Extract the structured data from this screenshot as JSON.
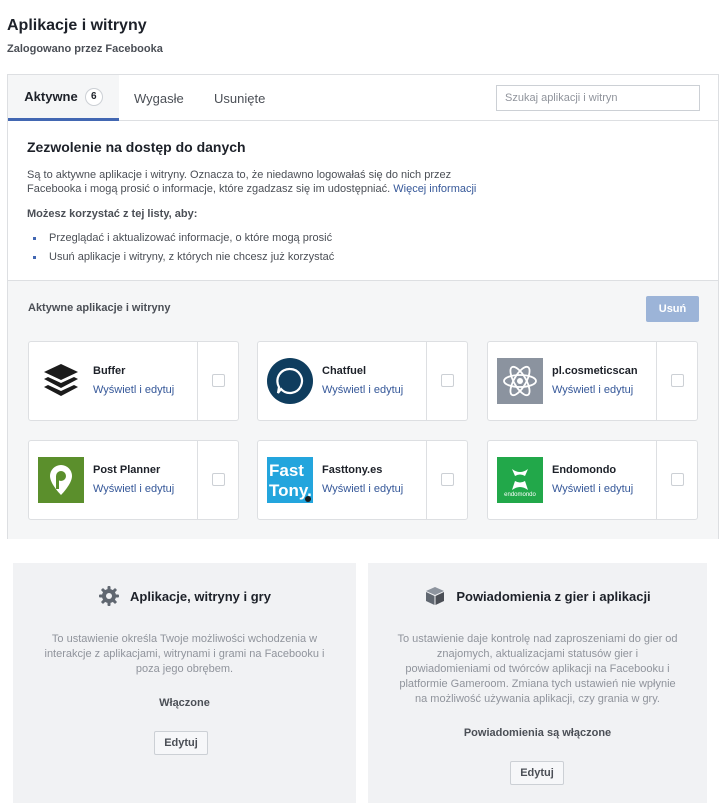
{
  "header": {
    "title": "Aplikacje i witryny",
    "subtitle": "Zalogowano przez Facebooka"
  },
  "tabs": [
    {
      "label": "Aktywne",
      "count": "6",
      "active": true
    },
    {
      "label": "Wygasłe"
    },
    {
      "label": "Usunięte"
    }
  ],
  "search": {
    "placeholder": "Szukaj aplikacji i witryn",
    "value": ""
  },
  "info": {
    "title": "Zezwolenie na dostęp do danych",
    "description": "Są to aktywne aplikacje i witryny. Oznacza to, że niedawno logowałaś się do nich przez Facebooka i mogą prosić o informacje, które zgadzasz się im udostępniać.",
    "more_link": "Więcej informacji",
    "subtitle": "Możesz korzystać z tej listy, aby:",
    "bullets": [
      "Przeglądać i aktualizować informacje, o które mogą prosić",
      "Usuń aplikacje i witryny, z których nie chcesz już korzystać"
    ]
  },
  "apps_section": {
    "header": "Aktywne aplikacje i witryny",
    "remove_label": "Usuń",
    "edit_label": "Wyświetl i edytuj",
    "apps": [
      {
        "name": "Buffer",
        "icon": "buffer-logo-icon"
      },
      {
        "name": "Chatfuel",
        "icon": "chatfuel-logo-icon"
      },
      {
        "name": "pl.cosmeticscan",
        "icon": "atom-logo-icon"
      },
      {
        "name": "Post Planner",
        "icon": "post-planner-logo-icon"
      },
      {
        "name": "Fasttony.es",
        "icon": "fasttony-logo-icon",
        "logo_text": [
          "Fast",
          "Tony."
        ]
      },
      {
        "name": "Endomondo",
        "icon": "endomondo-logo-icon",
        "logo_text": "endomondo"
      }
    ]
  },
  "bottom": [
    {
      "title": "Aplikacje, witryny i gry",
      "icon": "gear-icon",
      "description": "To ustawienie określa Twoje możliwości wchodzenia w interakcje z aplikacjami, witrynami i grami na Facebooku i poza jego obrębem.",
      "status": "Włączone",
      "edit_label": "Edytuj"
    },
    {
      "title": "Powiadomienia z gier i aplikacji",
      "icon": "cube-icon",
      "description": "To ustawienie daje kontrolę nad zaproszeniami do gier od znajomych, aktualizacjami statusów gier i powiadomieniami od twórców aplikacji na Facebooku i platformie Gameroom. Zmiana tych ustawień nie wpłynie na możliwość używania aplikacji, czy grania w gry.",
      "status": "Powiadomienia są włączone",
      "edit_label": "Edytuj"
    }
  ],
  "colors": {
    "accent": "#4267b2",
    "link": "#365899",
    "remove_button": "#9cb4d8",
    "chatfuel": "#0f3d5e",
    "cosmeticscan": "#8b939f",
    "post_planner": "#5b8f2c",
    "fasttony": "#23a5dd",
    "endomondo": "#22a84a"
  }
}
